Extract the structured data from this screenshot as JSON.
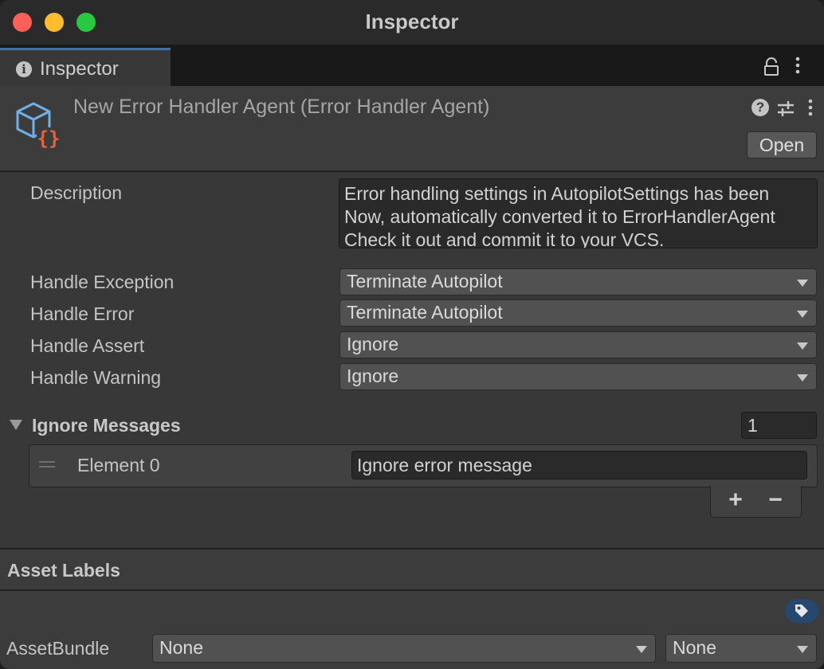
{
  "window": {
    "title": "Inspector"
  },
  "tab": {
    "label": "Inspector",
    "info_glyph": "i"
  },
  "header": {
    "asset_title": "New Error Handler Agent (Error Handler Agent)",
    "help_glyph": "?",
    "open_label": "Open"
  },
  "fields": {
    "description_label": "Description",
    "description_lines": [
      "Error handling settings in AutopilotSettings has been",
      "Now, automatically converted it to ErrorHandlerAgent",
      "Check it out and commit it to your VCS."
    ],
    "handle_exception": {
      "label": "Handle Exception",
      "value": "Terminate Autopilot"
    },
    "handle_error": {
      "label": "Handle Error",
      "value": "Terminate Autopilot"
    },
    "handle_assert": {
      "label": "Handle Assert",
      "value": "Ignore"
    },
    "handle_warning": {
      "label": "Handle Warning",
      "value": "Ignore"
    }
  },
  "ignore_messages": {
    "label": "Ignore Messages",
    "count": "1",
    "elements": [
      {
        "label": "Element 0",
        "value": "Ignore error message"
      }
    ],
    "add_glyph": "+",
    "remove_glyph": "−"
  },
  "asset_labels": {
    "title": "Asset Labels",
    "bundle_label": "AssetBundle",
    "bundle_name": "None",
    "bundle_variant": "None"
  },
  "colors": {
    "tab_accent": "#3a72b0",
    "icon_blue": "#6fb0e8",
    "icon_orange": "#e8623a",
    "tag_button_bg": "#24486e"
  },
  "icons": {
    "tab": "info-icon",
    "asset": "scriptable-object-icon",
    "lock": "lock-icon",
    "help": "help-icon",
    "presets": "sliders-icon",
    "menu": "kebab-menu-icon",
    "tag": "tag-icon"
  }
}
